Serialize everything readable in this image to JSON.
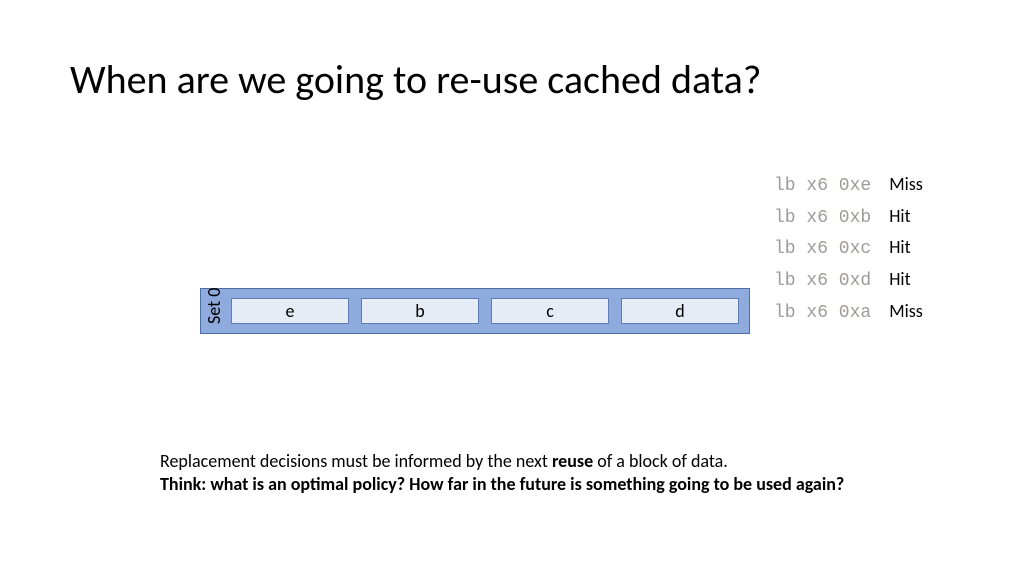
{
  "title": "When are we going to re-use cached data?",
  "cache": {
    "set_label": "Set 0",
    "ways": [
      "e",
      "b",
      "c",
      "d"
    ]
  },
  "trace": [
    {
      "instr": "lb x6 0xe",
      "result": "Miss"
    },
    {
      "instr": "lb x6 0xb",
      "result": "Hit"
    },
    {
      "instr": "lb x6 0xc",
      "result": "Hit"
    },
    {
      "instr": "lb x6 0xd",
      "result": "Hit"
    },
    {
      "instr": "lb x6 0xa",
      "result": "Miss"
    }
  ],
  "body": {
    "line1_pre": "Replacement decisions must be informed by the next ",
    "line1_bold": "reuse",
    "line1_post": " of a block of data.",
    "line2": "Think: what is an optimal policy?  How far in the future is something going to be used again?"
  }
}
